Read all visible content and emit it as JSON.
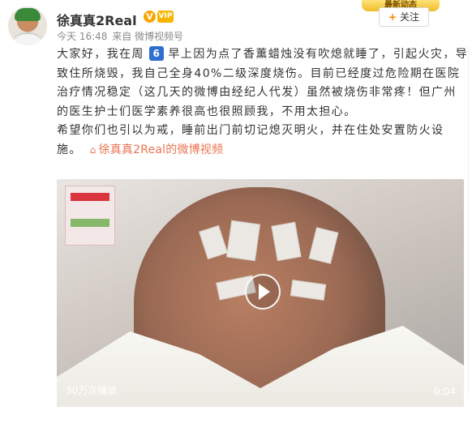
{
  "post": {
    "user": {
      "name": "徐真真2Real",
      "verified": true,
      "vip": true
    },
    "meta": {
      "time": "今天 16:48",
      "from": "来自 微博视频号"
    },
    "follow_button": "关注",
    "top_tag": "最新动态",
    "text": {
      "line1a": "大家好，我在周",
      "day": "6",
      "line1b": "早上因为点了香薰蜡烛没有吹熄就睡了，引起火灾，导致住所烧毁，我自己全身40%二级深度烧伤。目前已经度过危险期在医院治疗情况稳定（这几天的微博由经纪人代发）虽然被烧伤非常疼！但广州的医生护士们医学素养很高也很照顾我，不用太担心。",
      "line2": "希望你们也引以为戒，睡前出门前切记熄灭明火，并在住处安置防火设施。",
      "video_link": "徐真真2Real的微博视频"
    },
    "video": {
      "views": "30万次播放",
      "duration": "0:04"
    }
  }
}
